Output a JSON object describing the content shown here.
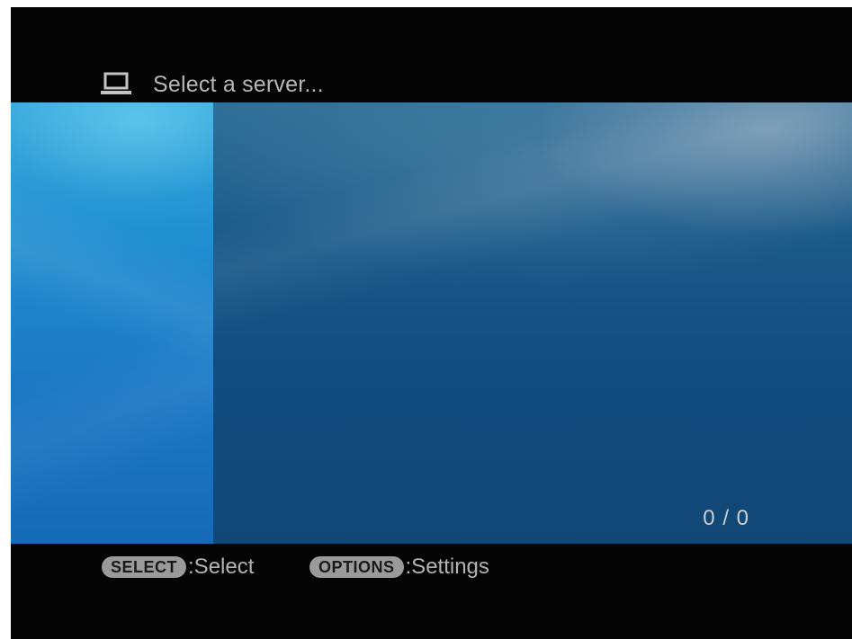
{
  "header": {
    "icon": "server-icon",
    "title": "Select a server..."
  },
  "content": {
    "counter": "0 / 0"
  },
  "footer": {
    "hints": [
      {
        "key": "SELECT",
        "action": ":Select"
      },
      {
        "key": "OPTIONS",
        "action": ":Settings"
      }
    ]
  },
  "colors": {
    "background": "#040404",
    "left_panel": "#1f8fd0",
    "main_panel": "#134c80",
    "text": "#b7b7b7",
    "key_pill": "#9a9a9a"
  }
}
